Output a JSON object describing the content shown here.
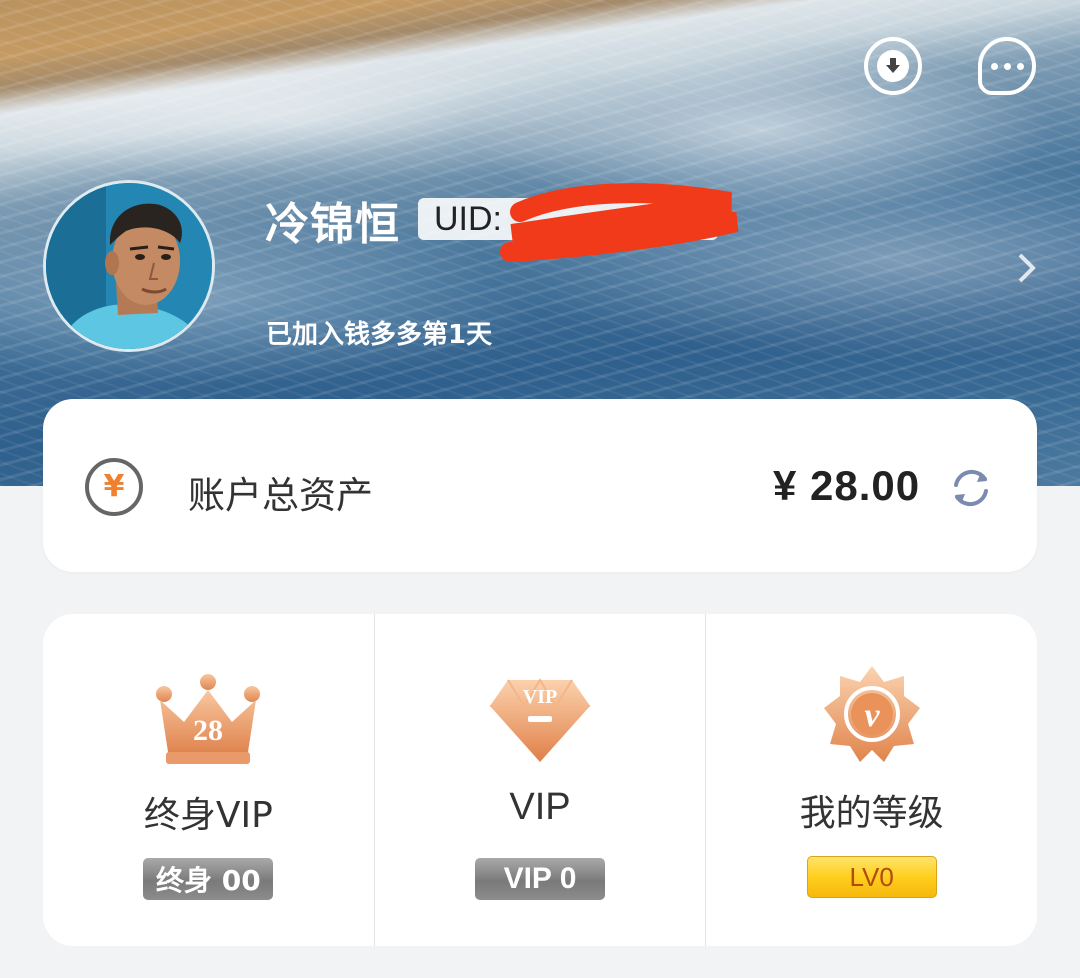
{
  "header": {
    "download_icon": "download-icon",
    "message_icon": "message-bubble-icon",
    "user": {
      "name": "冷锦恒",
      "uid_label": "UID:",
      "join_text": "已加入钱多多第1天"
    },
    "arrow_icon": "chevron-right-icon"
  },
  "assets": {
    "icon": "yen-icon",
    "label": "账户总资产",
    "amount": "¥ 28.00",
    "refresh_icon": "refresh-icon"
  },
  "vip": {
    "lifetime": {
      "icon": "crown-icon",
      "crown_number": "28",
      "title": "终身VIP",
      "badge": "终身 00"
    },
    "vip": {
      "icon": "diamond-vip-icon",
      "gem_text": "VIP",
      "title": "VIP",
      "badge": "VIP 0"
    },
    "level": {
      "icon": "level-medal-icon",
      "medal_letter": "v",
      "title": "我的等级",
      "badge": "LV0"
    }
  },
  "colors": {
    "accent_orange": "#f07f2e",
    "level_gold": "#ffcf1e",
    "level_text": "#b34a10",
    "emblem_bronze": "#e8945a"
  }
}
